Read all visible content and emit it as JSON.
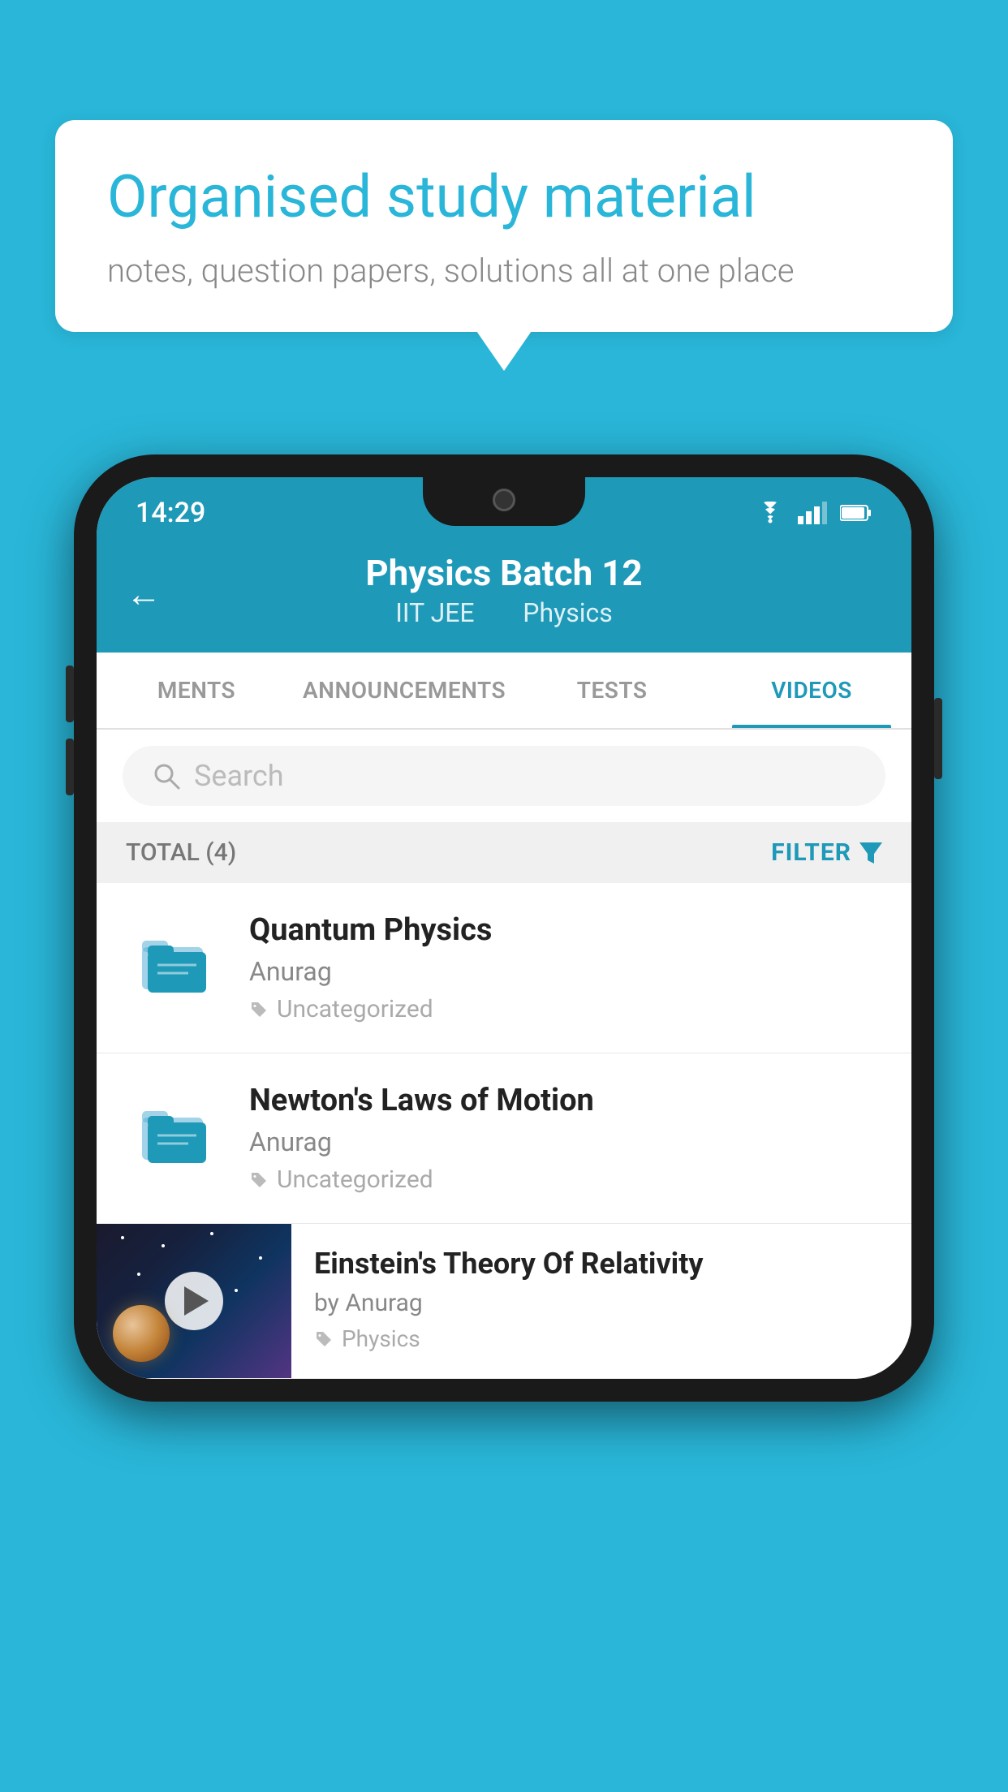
{
  "background_color": "#29b6d8",
  "speech_bubble": {
    "heading": "Organised study material",
    "subtext": "notes, question papers, solutions all at one place"
  },
  "phone": {
    "status_bar": {
      "time": "14:29",
      "icons": [
        "wifi",
        "signal",
        "battery"
      ]
    },
    "header": {
      "back_label": "←",
      "title": "Physics Batch 12",
      "subtitle_left": "IIT JEE",
      "subtitle_right": "Physics"
    },
    "tabs": [
      {
        "label": "MENTS",
        "active": false
      },
      {
        "label": "ANNOUNCEMENTS",
        "active": false
      },
      {
        "label": "TESTS",
        "active": false
      },
      {
        "label": "VIDEOS",
        "active": true
      }
    ],
    "search": {
      "placeholder": "Search"
    },
    "filter_bar": {
      "total_label": "TOTAL (4)",
      "filter_label": "FILTER"
    },
    "videos": [
      {
        "title": "Quantum Physics",
        "author": "Anurag",
        "tag": "Uncategorized",
        "type": "folder"
      },
      {
        "title": "Newton's Laws of Motion",
        "author": "Anurag",
        "tag": "Uncategorized",
        "type": "folder"
      },
      {
        "title": "Einstein's Theory Of Relativity",
        "author": "by Anurag",
        "tag": "Physics",
        "type": "video"
      }
    ]
  }
}
